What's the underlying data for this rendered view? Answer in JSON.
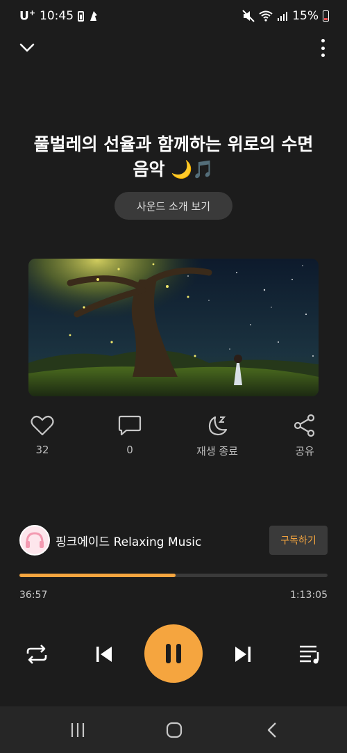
{
  "status": {
    "carrier": "U",
    "carrier_sup": "+",
    "time": "10:45",
    "battery_percent": "15%"
  },
  "top": {
    "collapse_icon": "chevron-down-icon",
    "more_icon": "more-vertical-icon"
  },
  "track": {
    "title": "풀벌레의 선율과 함께하는 위로의 수면음악 🌙🎵",
    "intro_button": "사운드 소개 보기",
    "artwork_icon": "artwork-image"
  },
  "actions": {
    "like_count": "32",
    "comment_count": "0",
    "sleep_timer_label": "재생 종료",
    "share_label": "공유"
  },
  "channel": {
    "name": "핑크에이드 Relaxing Music",
    "subscribe_label": "구독하기"
  },
  "playback": {
    "elapsed": "36:57",
    "duration": "1:13:05",
    "progress": 0.506
  },
  "colors": {
    "accent": "#f5a53f",
    "background": "#1c1c1c"
  }
}
